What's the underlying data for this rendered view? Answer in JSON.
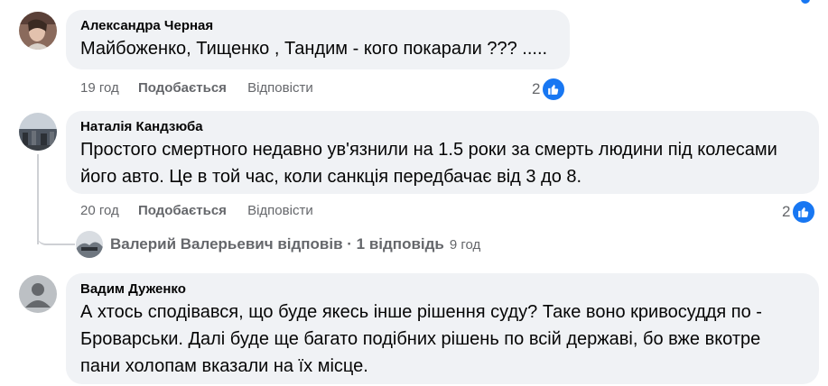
{
  "comments": [
    {
      "author": "Александра Черная",
      "text_lines": [
        "Майбоженко, Тищенко , Тандим - кого покарали ??? ....."
      ],
      "time": "19 год",
      "like_label": "Подобається",
      "reply_label": "Відповісти",
      "reaction_count": "2",
      "reaction_icon": "like-icon"
    },
    {
      "author": "Наталія Кандзюба",
      "text_lines": [
        "Простого смертного недавно ув'язнили на 1.5 роки за смерть людини під колесами",
        "його авто. Це в той час, коли санкція передбачає від 3 до 8."
      ],
      "time": "20 год",
      "like_label": "Подобається",
      "reply_label": "Відповісти",
      "reaction_count": "2",
      "reaction_icon": "like-icon",
      "replies_summary": {
        "text": "Валерий Валерьевич відповів · 1 відповідь",
        "time": "9 год"
      }
    },
    {
      "author": "Вадим Дуженко",
      "text_lines": [
        "А хтось сподівався, що буде якесь інше рішення суду? Таке воно кривосуддя по -",
        "Броварськи. Далі буде ще багато подібних рішень по всій державі, бо вже вкотре",
        "пани холопам вказали на їх місце."
      ]
    }
  ],
  "colors": {
    "bubble": "#f0f2f5",
    "secondary_text": "#65676b",
    "like_blue": "#1877f2"
  }
}
